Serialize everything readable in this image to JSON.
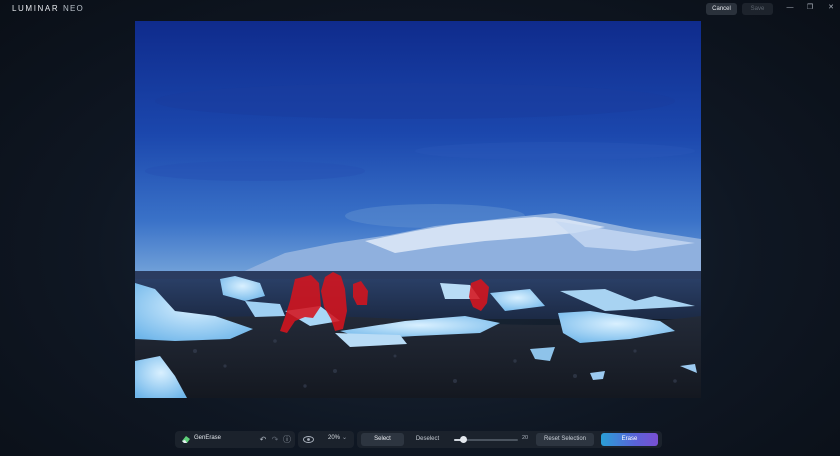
{
  "app": {
    "logo_main": "LUMINAR",
    "logo_sub": "NEO"
  },
  "header": {
    "cancel_label": "Cancel",
    "save_label": "Save"
  },
  "window_controls": {
    "minimize": "—",
    "maximize": "❐",
    "close": "✕"
  },
  "tool_panel": {
    "tool_name": "GenErase",
    "tool_icon": "eraser-icon",
    "undo_glyph": "↶",
    "redo_glyph": "↷",
    "info_glyph": "ⓘ"
  },
  "view_panel": {
    "visibility_icon": "eye-icon",
    "zoom_value": "20%",
    "zoom_chevron": "⌄"
  },
  "selection_panel": {
    "select_label": "Select",
    "deselect_label": "Deselect",
    "brush_size": "20",
    "brush_fraction": 0.15,
    "reset_label": "Reset Selection",
    "erase_label": "Erase"
  },
  "colors": {
    "mask": "#d5141e",
    "erase_gradient_start": "#2a9fd6",
    "erase_gradient_end": "#7a4fd2"
  }
}
